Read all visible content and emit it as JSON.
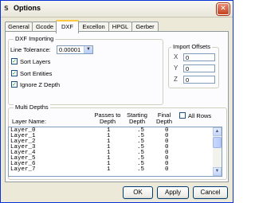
{
  "window": {
    "title": "Options",
    "app_icon_glyph": "S",
    "close_glyph": "✕"
  },
  "tabs": [
    {
      "label": "General"
    },
    {
      "label": "Gcode"
    },
    {
      "label": "DXF",
      "active": true
    },
    {
      "label": "Excellon"
    },
    {
      "label": "HPGL"
    },
    {
      "label": "Gerber"
    }
  ],
  "dxf_importing": {
    "legend": "DXF Importing",
    "line_tolerance_label": "Line Tolerance:",
    "line_tolerance_value": "0.00001",
    "sort_layers": {
      "label": "Sort Layers",
      "checked": true
    },
    "sort_entities": {
      "label": "Sort Entities",
      "checked": true
    },
    "ignore_z": {
      "label": "Ignore Z Depth",
      "checked": true
    },
    "check_glyph": "✓",
    "dropdown_glyph": "▼"
  },
  "import_offsets": {
    "legend": "Import Offsets",
    "x_label": "X",
    "x_value": "0",
    "y_label": "Y",
    "y_value": "0",
    "z_label": "Z",
    "z_value": "0"
  },
  "multi_depths": {
    "legend": "Multi Depths",
    "all_rows_label": "All Rows",
    "columns": {
      "layer_name": "Layer Name:",
      "passes_1": "Passes to",
      "passes_2": "Depth",
      "starting_1": "Starting",
      "starting_2": "Depth",
      "final_1": "Final",
      "final_2": "Depth"
    },
    "rows": [
      {
        "layer": "Layer_0",
        "passes": "1",
        "start": ".5",
        "final": "0"
      },
      {
        "layer": "Layer_1",
        "passes": "1",
        "start": ".5",
        "final": "0"
      },
      {
        "layer": "Layer_2",
        "passes": "1",
        "start": ".5",
        "final": "0"
      },
      {
        "layer": "Layer_3",
        "passes": "1",
        "start": ".5",
        "final": "0"
      },
      {
        "layer": "Layer_4",
        "passes": "1",
        "start": ".5",
        "final": "0"
      },
      {
        "layer": "Layer_5",
        "passes": "1",
        "start": ".5",
        "final": "0"
      },
      {
        "layer": "Layer_6",
        "passes": "1",
        "start": ".5",
        "final": "0"
      },
      {
        "layer": "Layer_7",
        "passes": "1",
        "start": ".5",
        "final": "0"
      }
    ],
    "scroll_up_glyph": "▲",
    "scroll_down_glyph": "▼"
  },
  "buttons": {
    "ok": "OK",
    "apply": "Apply",
    "cancel": "Cancel"
  },
  "icons": {
    "app": "app-icon",
    "close": "close-icon",
    "dropdown": "chevron-down-icon",
    "scroll_up": "scroll-up-icon",
    "scroll_down": "scroll-down-icon"
  },
  "colors": {
    "title_close": "#c44520",
    "tab_active_accent": "#ffc83c",
    "input_border": "#7f9db9",
    "check": "#21a121"
  }
}
